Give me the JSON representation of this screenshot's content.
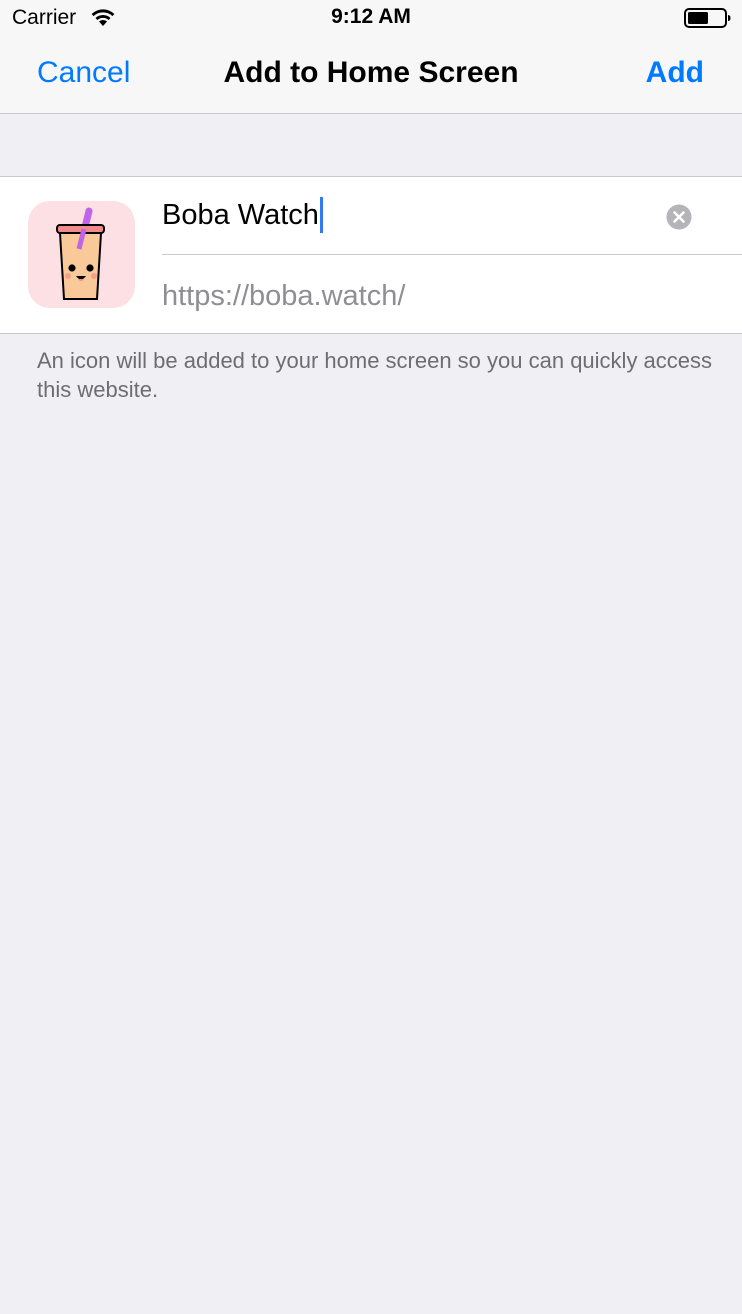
{
  "status_bar": {
    "carrier": "Carrier",
    "time": "9:12 AM",
    "wifi_icon": "wifi-icon",
    "battery_icon": "battery-icon"
  },
  "nav": {
    "cancel_label": "Cancel",
    "title": "Add to Home Screen",
    "add_label": "Add"
  },
  "form": {
    "app_icon": "boba-cup-icon",
    "name_value": "Boba Watch",
    "clear_icon": "clear-text-icon",
    "url": "https://boba.watch/"
  },
  "footer": {
    "note": "An icon will be added to your home screen so you can quickly access this website."
  },
  "colors": {
    "accent": "#007aff",
    "background": "#efeff4",
    "icon_background": "#fde0e3",
    "straw": "#c064e8",
    "cup": "#f9c99a"
  }
}
